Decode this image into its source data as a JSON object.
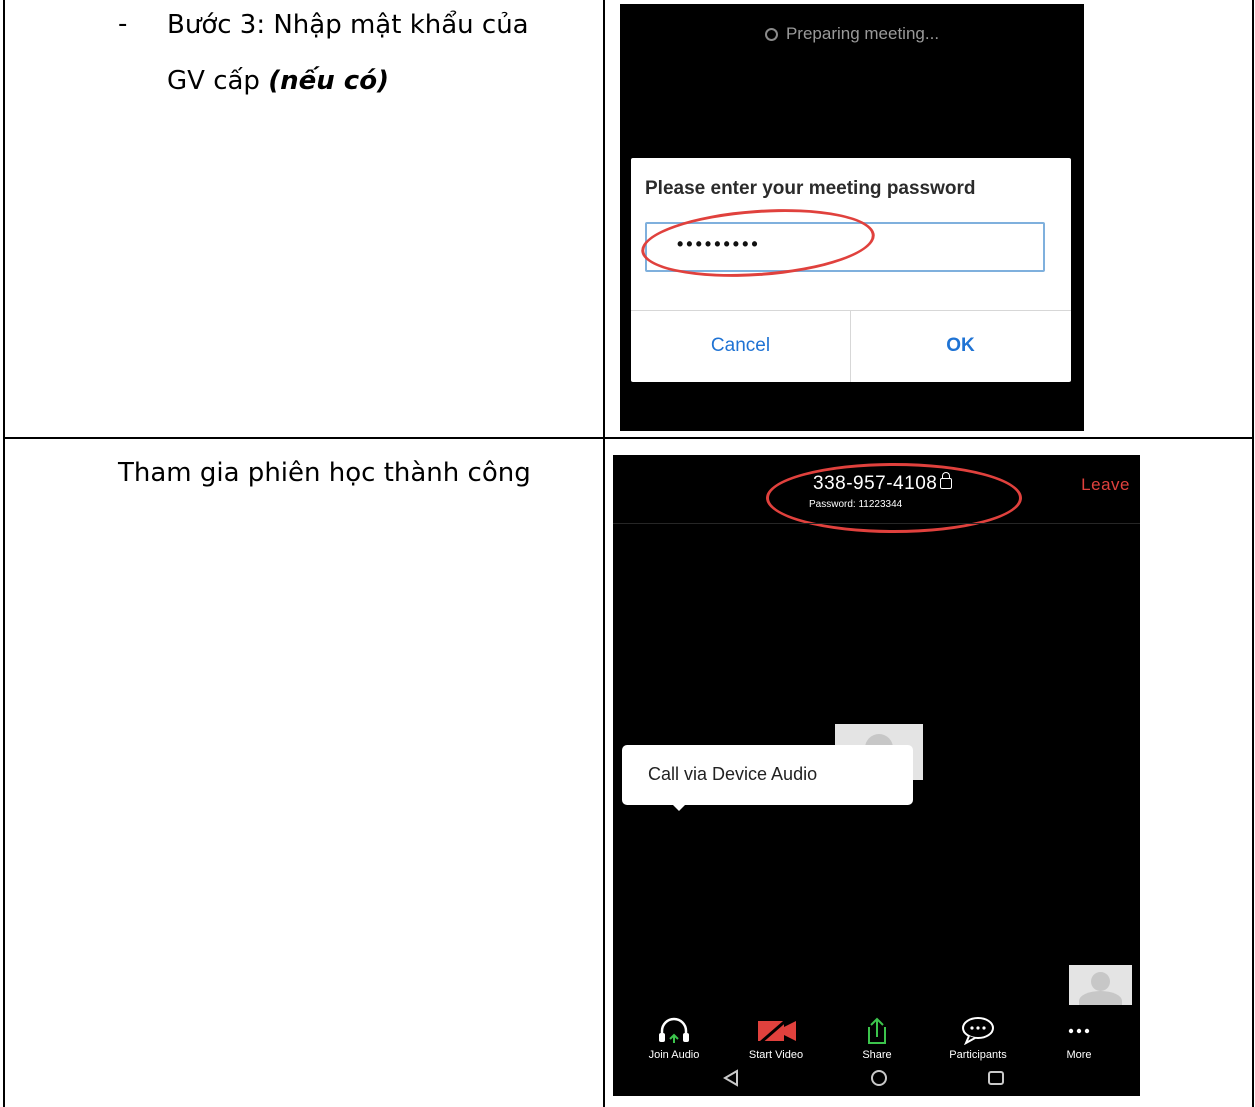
{
  "rows": [
    {
      "dash": "-",
      "line1": "Bước 3: Nhập mật khẩu của",
      "line2_prefix": "GV cấp ",
      "line2_emphasis": "(nếu có)"
    },
    {
      "text": "Tham gia phiên học thành công"
    }
  ],
  "screen1": {
    "status": "Preparing meeting...",
    "dialog_title": "Please enter your meeting password",
    "password_masked": "•••••••••",
    "cancel_label": "Cancel",
    "ok_label": "OK"
  },
  "screen2": {
    "meeting_id": "338-957-4108",
    "password_line": "Password: 11223344",
    "leave_label": "Leave",
    "tooltip": "Call via Device Audio",
    "toolbar": [
      {
        "label": "Join Audio",
        "icon": "headphones-icon"
      },
      {
        "label": "Start Video",
        "icon": "video-off-icon"
      },
      {
        "label": "Share",
        "icon": "share-icon"
      },
      {
        "label": "Participants",
        "icon": "chat-bubble-icon"
      },
      {
        "label": "More",
        "icon": "more-icon"
      }
    ],
    "nav": [
      "back-icon",
      "home-icon",
      "recents-icon"
    ]
  },
  "colors": {
    "accent_red": "#e0413d",
    "link_blue": "#1f73d4",
    "share_green": "#3cc44c"
  }
}
